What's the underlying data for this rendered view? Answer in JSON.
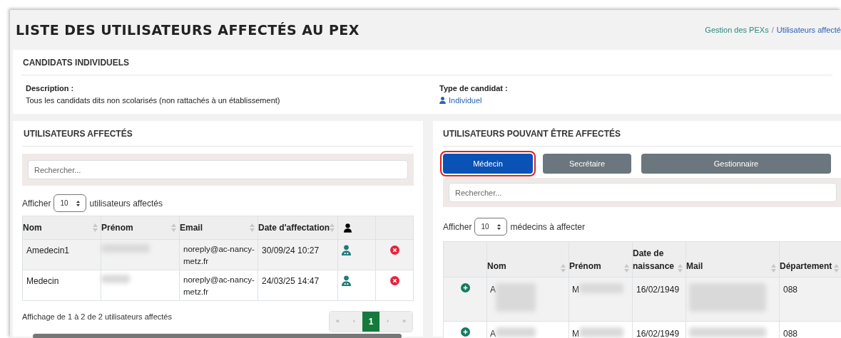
{
  "page": {
    "title": "LISTE DES UTILISATEURS AFFECTÉS AU PEX"
  },
  "breadcrumb_separator": "/",
  "breadcrumb": [
    {
      "label": "Gestion des PEXs",
      "kind": "link"
    },
    {
      "label": "Utilisateurs affecté",
      "kind": "current"
    }
  ],
  "candidate_card": {
    "title": "CANDIDATS INDIVIDUELS",
    "description_label": "Description :",
    "description": "Tous les candidats dits non scolarisés (non rattachés à un établissement)",
    "type_label": "Type de candidat :",
    "type_value": "Individuel"
  },
  "assigned": {
    "title": "UTILISATEURS AFFECTÉS",
    "search_placeholder": "Rechercher...",
    "length_prefix": "Afficher",
    "length_value": "10",
    "length_suffix": "utilisateurs affectés",
    "columns": [
      {
        "kind": "text",
        "label": "Nom"
      },
      {
        "kind": "text",
        "label": "Prénom"
      },
      {
        "kind": "text",
        "label": "Email"
      },
      {
        "kind": "text",
        "label": "Date d'affectation"
      },
      {
        "kind": "icon"
      },
      {
        "kind": "blank"
      }
    ],
    "rows": [
      {
        "nom": "Amedecin1",
        "email": "noreply@ac-nancy-metz.fr",
        "date": "30/09/24 10:27"
      },
      {
        "nom": "Medecin",
        "email": "noreply@ac-nancy-metz.fr",
        "date": "24/03/25 14:47"
      }
    ],
    "info": "Affichage de 1 à 2 de 2 utilisateurs affectés",
    "pagination": [
      {
        "label": "«",
        "selected": false,
        "disabled": true
      },
      {
        "label": "‹",
        "selected": false,
        "disabled": true
      },
      {
        "label": "1",
        "selected": true,
        "disabled": false
      },
      {
        "label": "›",
        "selected": false,
        "disabled": true
      },
      {
        "label": "»",
        "selected": false,
        "disabled": true
      }
    ]
  },
  "assignable": {
    "title": "UTILISATEURS POUVANT ÊTRE AFFECTÉS",
    "roles": [
      {
        "label": "Médecin",
        "selected": true
      },
      {
        "label": "Secrétaire",
        "selected": false
      },
      {
        "label": "Gestionnaire",
        "selected": false
      }
    ],
    "search_placeholder": "Rechercher...",
    "length_prefix": "Afficher",
    "length_value": "10",
    "length_suffix": "médecins à affecter",
    "columns": [
      {
        "kind": "blank"
      },
      {
        "kind": "text",
        "label": "Nom"
      },
      {
        "kind": "text",
        "label": "Prénom"
      },
      {
        "kind": "text",
        "label": "Date de naissance"
      },
      {
        "kind": "text",
        "label": "Mail"
      },
      {
        "kind": "text",
        "label": "Département"
      }
    ],
    "rows": [
      {
        "nom": "A",
        "prenom": "M",
        "birth": "16/02/1949",
        "departement": "088"
      },
      {
        "nom": "A",
        "prenom": "M",
        "birth": "16/02/1949",
        "departement": "088"
      }
    ]
  }
}
